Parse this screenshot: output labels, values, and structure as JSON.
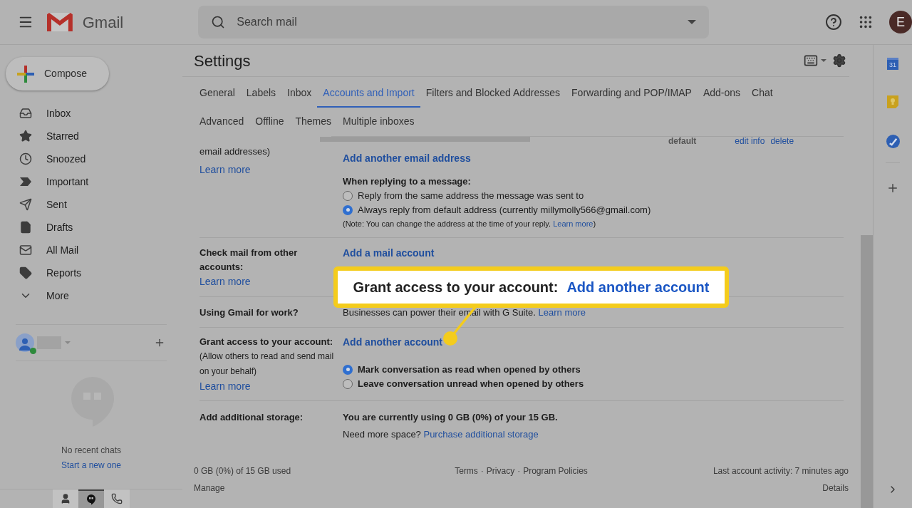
{
  "header": {
    "app_name": "Gmail",
    "search": {
      "placeholder": "Search mail"
    },
    "avatar_letter": "E"
  },
  "sidebar": {
    "compose": "Compose",
    "items": [
      {
        "label": "Inbox",
        "kind": "inbox",
        "selected": false
      },
      {
        "label": "Starred",
        "kind": "star",
        "selected": false
      },
      {
        "label": "Snoozed",
        "kind": "clock",
        "selected": false
      },
      {
        "label": "Important",
        "kind": "important",
        "selected": false
      },
      {
        "label": "Sent",
        "kind": "send",
        "selected": false
      },
      {
        "label": "Drafts",
        "kind": "file",
        "selected": false
      },
      {
        "label": "All Mail",
        "kind": "mail",
        "selected": false
      },
      {
        "label": "Reports",
        "kind": "label",
        "selected": false
      },
      {
        "label": "More",
        "kind": "more",
        "selected": false
      }
    ],
    "chat": {
      "empty_text": "No recent chats",
      "link": "Start a new one",
      "tabs": [
        {
          "kind": "person",
          "selected": false
        },
        {
          "kind": "hangouts",
          "selected": true
        },
        {
          "kind": "phone",
          "selected": false
        }
      ]
    }
  },
  "settings": {
    "title": "Settings",
    "tabs": [
      {
        "label": "General",
        "selected": false
      },
      {
        "label": "Labels",
        "selected": false
      },
      {
        "label": "Inbox",
        "selected": false
      },
      {
        "label": "Accounts and Import",
        "selected": true
      },
      {
        "label": "Filters and Blocked Addresses",
        "selected": false
      },
      {
        "label": "Forwarding and POP/IMAP",
        "selected": false
      },
      {
        "label": "Add-ons",
        "selected": false
      },
      {
        "label": "Chat",
        "selected": false
      },
      {
        "label": "Advanced",
        "selected": false
      },
      {
        "label": "Offline",
        "selected": false
      },
      {
        "label": "Themes",
        "selected": false
      },
      {
        "label": "Multiple inboxes",
        "selected": false
      }
    ],
    "account_row": {
      "status": "default",
      "actions": [
        "edit info",
        "delete"
      ]
    },
    "send_mail": {
      "label": "email addresses)",
      "learn_more": "Learn more",
      "add_link": "Add another email address",
      "reply_heading": "When replying to a message:",
      "radios": [
        {
          "label": "Reply from the same address the message was sent to",
          "selected": false
        },
        {
          "label": "Always reply from default address (currently millymolly566@gmail.com)",
          "selected": true
        }
      ],
      "note": {
        "text": "(Note: You can change the address at the time of your reply.",
        "link": "Learn more",
        "end": ")"
      }
    },
    "check_mail": {
      "label": "Check mail from other accounts:",
      "learn_more": "Learn more",
      "add_link": "Add a mail account"
    },
    "work": {
      "label": "Using Gmail for work?",
      "text": "Businesses can power their email with G Suite.",
      "link": "Learn more"
    },
    "grant_access": {
      "label": "Grant access to your account:",
      "description": "(Allow others to read and send mail on your behalf)",
      "learn_more": "Learn more",
      "add_link": "Add another account",
      "radios": [
        {
          "label": "Mark conversation as read when opened by others",
          "selected": true
        },
        {
          "label": "Leave conversation unread when opened by others",
          "selected": false
        }
      ]
    },
    "storage": {
      "label": "Add additional storage:",
      "usage": "You are currently using 0 GB (0%) of your 15 GB.",
      "prompt": "Need more space?",
      "link": "Purchase additional storage"
    },
    "footer": {
      "usage": "0 GB (0%) of 15 GB used",
      "manage": "Manage",
      "links": [
        "Terms",
        "Privacy",
        "Program Policies"
      ],
      "separator": "·",
      "activity": "Last account activity: 7 minutes ago",
      "details": "Details"
    }
  },
  "callout": {
    "label": "Grant access to your account:",
    "link": "Add another account"
  },
  "side_panel": {
    "calendar_day": "31"
  }
}
